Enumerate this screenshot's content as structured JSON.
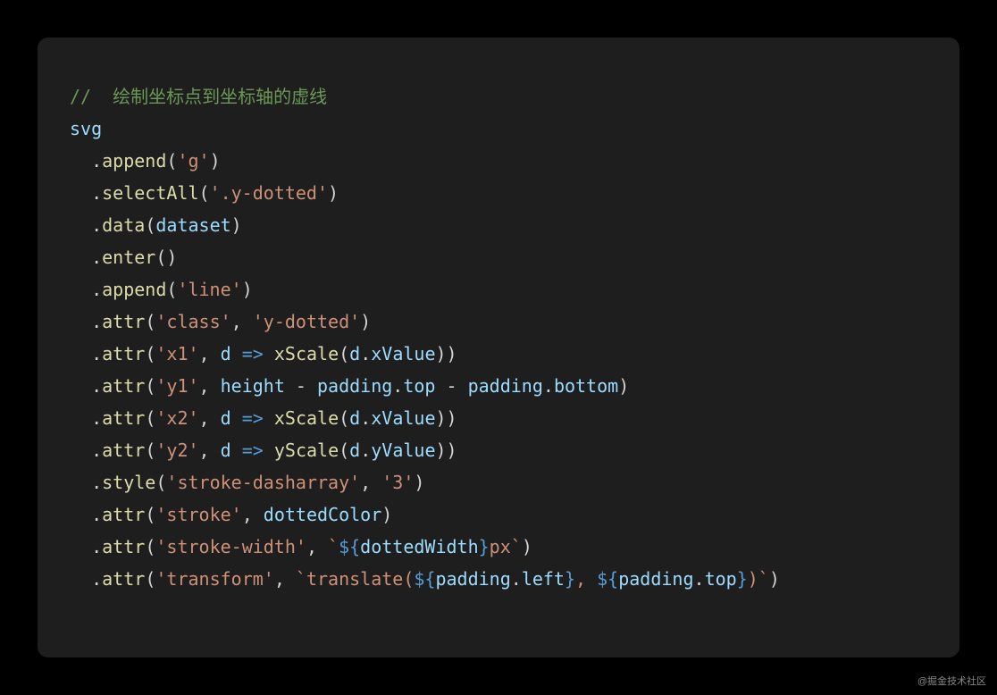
{
  "watermark": "@掘金技术社区",
  "code": {
    "comment": "//  绘制坐标点到坐标轴的虚线",
    "svg": "svg",
    "indent": "  ",
    "lines": [
      {
        "method": "append",
        "args": [
          {
            "t": "str",
            "v": "'g'"
          }
        ]
      },
      {
        "method": "selectAll",
        "args": [
          {
            "t": "str",
            "v": "'.y-dotted'"
          }
        ]
      },
      {
        "method": "data",
        "args": [
          {
            "t": "var",
            "v": "dataset"
          }
        ]
      },
      {
        "method": "enter",
        "args": []
      },
      {
        "method": "append",
        "args": [
          {
            "t": "str",
            "v": "'line'"
          }
        ]
      },
      {
        "method": "attr",
        "args": [
          {
            "t": "str",
            "v": "'class'"
          },
          {
            "t": "str",
            "v": "'y-dotted'"
          }
        ]
      },
      {
        "method": "attr",
        "args": [
          {
            "t": "str",
            "v": "'x1'"
          },
          {
            "t": "arrow",
            "param": "d",
            "call": "xScale",
            "obj": "d",
            "prop": "xValue"
          }
        ]
      },
      {
        "method": "attr",
        "args": [
          {
            "t": "str",
            "v": "'y1'"
          },
          {
            "t": "expr",
            "parts": [
              {
                "t": "var",
                "v": "height"
              },
              {
                "t": "op",
                "v": " - "
              },
              {
                "t": "var",
                "v": "padding"
              },
              {
                "t": "dot",
                "v": "."
              },
              {
                "t": "prop",
                "v": "top"
              },
              {
                "t": "op",
                "v": " - "
              },
              {
                "t": "var",
                "v": "padding"
              },
              {
                "t": "dot",
                "v": "."
              },
              {
                "t": "prop",
                "v": "bottom"
              }
            ]
          }
        ]
      },
      {
        "method": "attr",
        "args": [
          {
            "t": "str",
            "v": "'x2'"
          },
          {
            "t": "arrow",
            "param": "d",
            "call": "xScale",
            "obj": "d",
            "prop": "xValue"
          }
        ]
      },
      {
        "method": "attr",
        "args": [
          {
            "t": "str",
            "v": "'y2'"
          },
          {
            "t": "arrow",
            "param": "d",
            "call": "yScale",
            "obj": "d",
            "prop": "yValue"
          }
        ]
      },
      {
        "method": "style",
        "args": [
          {
            "t": "str",
            "v": "'stroke-dasharray'"
          },
          {
            "t": "str",
            "v": "'3'"
          }
        ]
      },
      {
        "method": "attr",
        "args": [
          {
            "t": "str",
            "v": "'stroke'"
          },
          {
            "t": "var",
            "v": "dottedColor"
          }
        ]
      },
      {
        "method": "attr",
        "args": [
          {
            "t": "str",
            "v": "'stroke-width'"
          },
          {
            "t": "tmpl",
            "parts": [
              {
                "t": "interp",
                "inner": [
                  {
                    "t": "var",
                    "v": "dottedWidth"
                  }
                ]
              },
              {
                "t": "txt",
                "v": "px"
              }
            ]
          }
        ]
      },
      {
        "method": "attr",
        "args": [
          {
            "t": "str",
            "v": "'transform'"
          },
          {
            "t": "tmpl",
            "parts": [
              {
                "t": "txt",
                "v": "translate("
              },
              {
                "t": "interp",
                "inner": [
                  {
                    "t": "var",
                    "v": "padding"
                  },
                  {
                    "t": "dot",
                    "v": "."
                  },
                  {
                    "t": "prop",
                    "v": "left"
                  }
                ]
              },
              {
                "t": "txt",
                "v": ", "
              },
              {
                "t": "interp",
                "inner": [
                  {
                    "t": "var",
                    "v": "padding"
                  },
                  {
                    "t": "dot",
                    "v": "."
                  },
                  {
                    "t": "prop",
                    "v": "top"
                  }
                ]
              },
              {
                "t": "txt",
                "v": ")"
              }
            ]
          }
        ]
      }
    ]
  }
}
